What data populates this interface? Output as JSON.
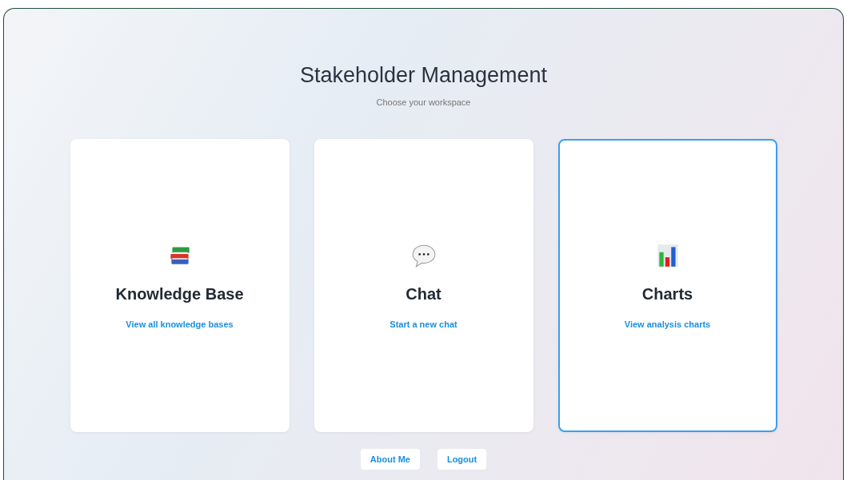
{
  "header": {
    "title": "Stakeholder Management",
    "subtitle": "Choose your workspace"
  },
  "cards": [
    {
      "kind": "books",
      "title": "Knowledge Base",
      "link": "View all knowledge bases",
      "selected": false
    },
    {
      "kind": "chat",
      "title": "Chat",
      "link": "Start a new chat",
      "selected": false
    },
    {
      "kind": "chart",
      "title": "Charts",
      "link": "View analysis charts",
      "selected": true
    }
  ],
  "buttons": [
    "About Me",
    "Logout"
  ]
}
